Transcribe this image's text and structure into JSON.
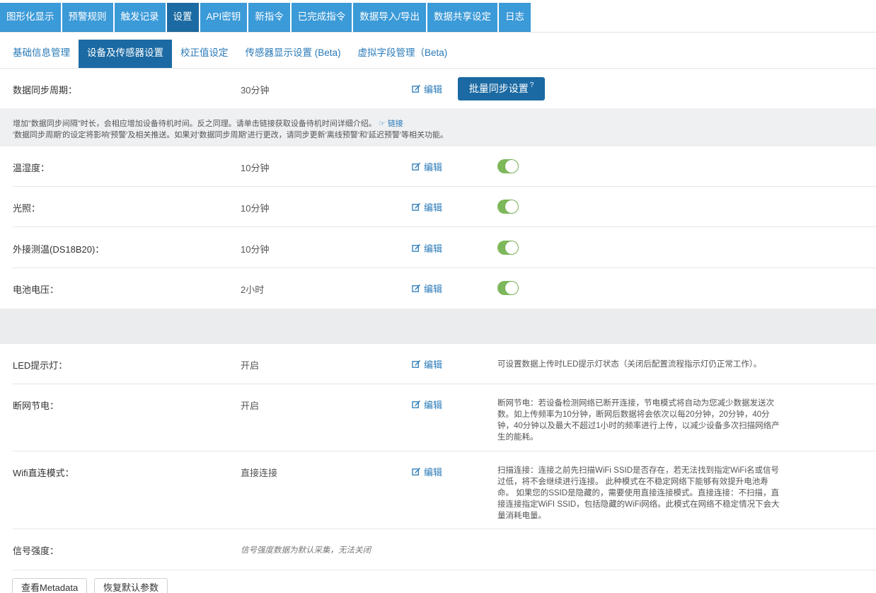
{
  "top_tabs": [
    {
      "label": "图形化显示"
    },
    {
      "label": "预警规则"
    },
    {
      "label": "触发记录"
    },
    {
      "label": "设置"
    },
    {
      "label": "API密钥"
    },
    {
      "label": "新指令"
    },
    {
      "label": "已完成指令"
    },
    {
      "label": "数据导入/导出"
    },
    {
      "label": "数据共享设定"
    },
    {
      "label": "日志"
    }
  ],
  "sub_tabs": [
    {
      "label": "基础信息管理"
    },
    {
      "label": "设备及传感器设置"
    },
    {
      "label": "校正值设定"
    },
    {
      "label": "传感器显示设置 (Beta)"
    },
    {
      "label": "虚拟字段管理（Beta)"
    }
  ],
  "edit_label": "编辑",
  "sync": {
    "label": "数据同步周期：",
    "value": "30分钟",
    "batch_button": "批量同步设置",
    "batch_help": "?"
  },
  "info": {
    "line1": "增加\"数据同步间隔\"时长，会相应增加设备待机时间。反之同理。请单击链接获取设备待机时间详细介绍。",
    "link": "链接",
    "line2": "'数据同步周期'的设定将影响'预警'及相关推送。如果对'数据同步周期'进行更改，请同步更新'离线预警'和'延迟预警'等相关功能。"
  },
  "sensors": [
    {
      "label": "温湿度：",
      "value": "10分钟",
      "enabled": true
    },
    {
      "label": "光照：",
      "value": "10分钟",
      "enabled": true
    },
    {
      "label": "外接测温(DS18B20)：",
      "value": "10分钟",
      "enabled": true
    },
    {
      "label": "电池电压：",
      "value": "2小时",
      "enabled": true
    }
  ],
  "settings": {
    "led": {
      "label": "LED提示灯：",
      "value": "开启",
      "desc": "可设置数据上传时LED提示灯状态（关闭后配置流程指示灯仍正常工作）。"
    },
    "power": {
      "label": "断网节电：",
      "value": "开启",
      "desc": "断网节电：若设备检测网络已断开连接，节电模式将自动为您减少数据发送次数。如上传频率为10分钟，断网后数据将会依次以每20分钟，20分钟，40分钟，40分钟以及最大不超过1小时的频率进行上传，以减少设备多次扫描网络产生的能耗。"
    },
    "wifi": {
      "label": "Wifi直连模式：",
      "value": "直接连接",
      "desc": "扫描连接：连接之前先扫描WiFi SSID是否存在，若无法找到指定WiFi名或信号过低，将不会继续进行连接。 此种模式在不稳定网络下能够有效提升电池寿命。 如果您的SSID是隐藏的，需要使用直接连接模式。直接连接：不扫描，直接连接指定WiFI SSID，包括隐藏的WiFi网络。此模式在网络不稳定情况下会大量消耗电量。"
    },
    "signal": {
      "label": "信号强度：",
      "note": "信号强度数据为默认采集，无法关闭"
    }
  },
  "footer": {
    "metadata_button": "查看Metadata",
    "reset_button": "恢复默认参数"
  },
  "colors": {
    "primary": "#1b6aa3",
    "tab": "#3b9ad8",
    "toggle_on": "#7db85a",
    "link": "#2a7ab8"
  }
}
